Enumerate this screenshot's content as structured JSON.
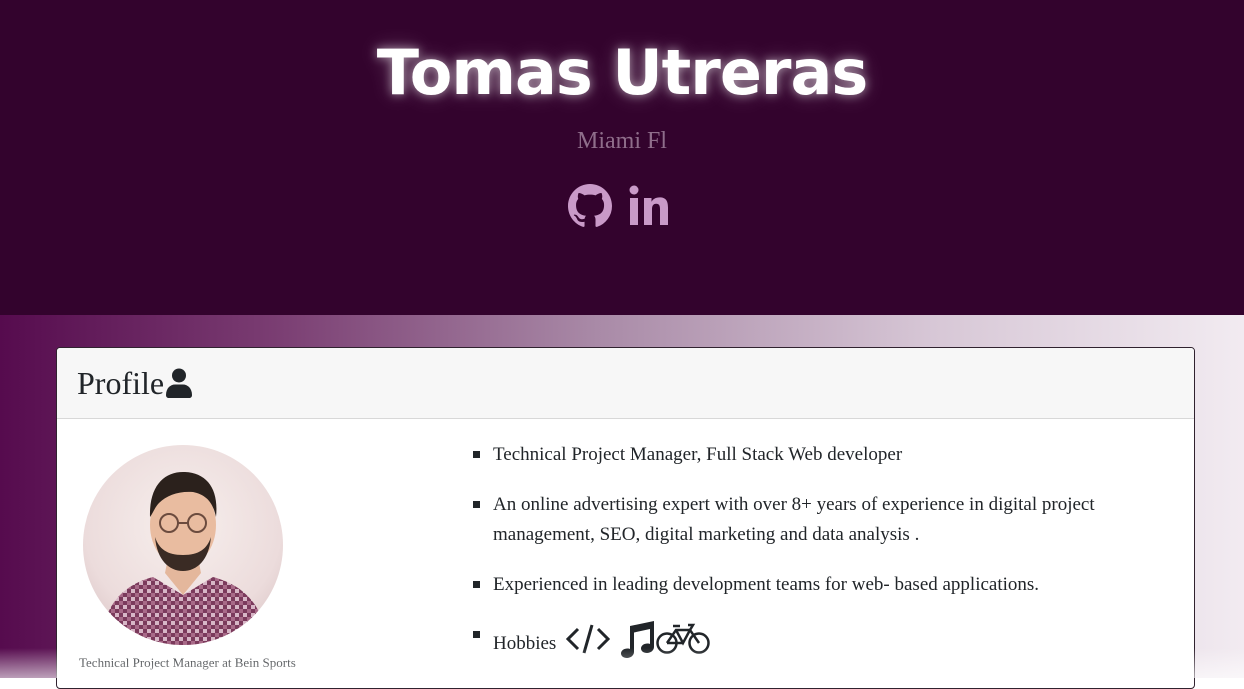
{
  "header": {
    "name": "Tomas Utreras",
    "location": "Miami Fl",
    "social_icons": [
      "github-icon",
      "linkedin-icon"
    ],
    "background_color": "#33032d",
    "icon_color": "#c99ac8"
  },
  "profile": {
    "title": "Profile",
    "title_icon": "user-icon",
    "photo_caption": "Technical Project Manager at Bein Sports",
    "bullets": [
      "Technical Project Manager, Full Stack Web developer",
      "An online advertising expert with over 8+ years of experience in digital project management, SEO, digital marketing and data analysis .",
      "Experienced in leading development teams for web- based applications.",
      "Hobbies"
    ],
    "hobby_icons": [
      "code-icon",
      "music-icon",
      "bicycle-icon"
    ]
  }
}
